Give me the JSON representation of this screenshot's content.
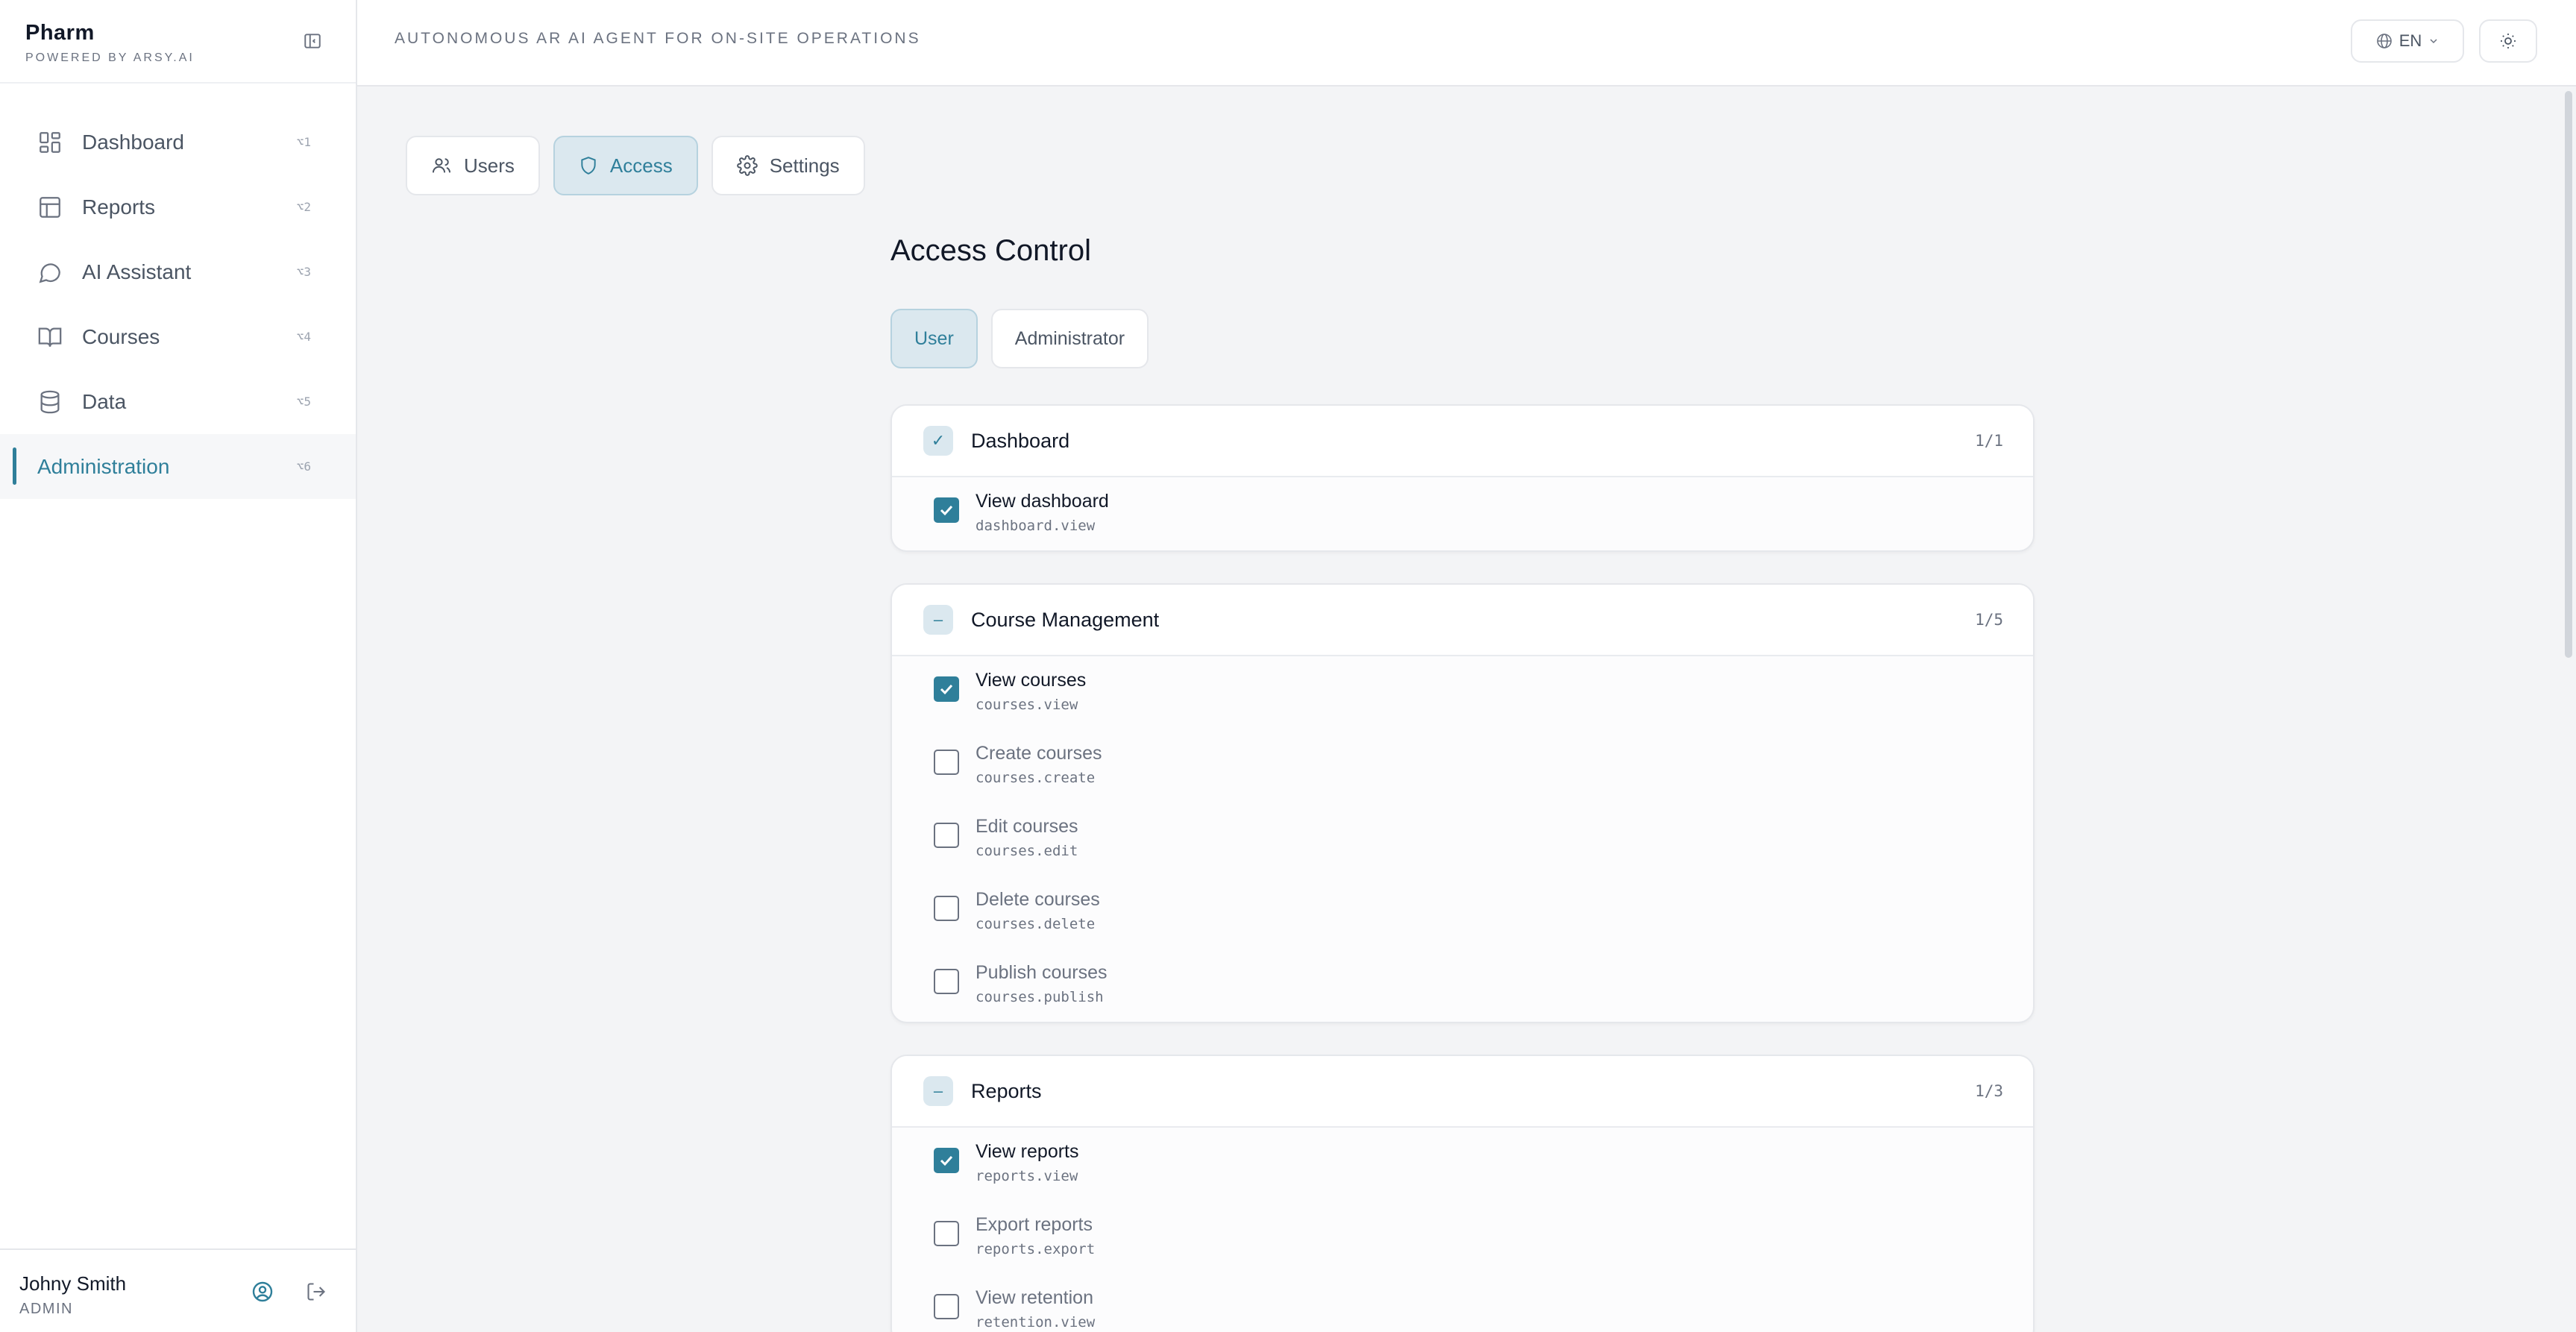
{
  "brand": {
    "name": "Pharm",
    "sub": "POWERED BY ARSY.AI"
  },
  "header": {
    "tagline": "AUTONOMOUS AR AI AGENT FOR ON-SITE OPERATIONS",
    "lang": "EN"
  },
  "sidebar": {
    "items": [
      {
        "label": "Dashboard",
        "shortcut": "⌥1",
        "icon": "dashboard-icon"
      },
      {
        "label": "Reports",
        "shortcut": "⌥2",
        "icon": "table-icon"
      },
      {
        "label": "AI Assistant",
        "shortcut": "⌥3",
        "icon": "chat-bubble-icon"
      },
      {
        "label": "Courses",
        "shortcut": "⌥4",
        "icon": "book-icon"
      },
      {
        "label": "Data",
        "shortcut": "⌥5",
        "icon": "database-icon"
      },
      {
        "label": "Administration",
        "shortcut": "⌥6",
        "active": true
      }
    ]
  },
  "user": {
    "name": "Johny Smith",
    "role": "ADMIN"
  },
  "tabs": [
    {
      "label": "Users",
      "icon": "users-icon"
    },
    {
      "label": "Access",
      "icon": "shield-icon",
      "active": true
    },
    {
      "label": "Settings",
      "icon": "gear-icon"
    }
  ],
  "page": {
    "title": "Access Control"
  },
  "roles": [
    {
      "label": "User",
      "active": true
    },
    {
      "label": "Administrator"
    }
  ],
  "groups": [
    {
      "title": "Dashboard",
      "count": "1/1",
      "toggle": "✓",
      "permissions": [
        {
          "label": "View dashboard",
          "key": "dashboard.view",
          "checked": true
        }
      ]
    },
    {
      "title": "Course Management",
      "count": "1/5",
      "toggle": "–",
      "permissions": [
        {
          "label": "View courses",
          "key": "courses.view",
          "checked": true
        },
        {
          "label": "Create courses",
          "key": "courses.create",
          "checked": false
        },
        {
          "label": "Edit courses",
          "key": "courses.edit",
          "checked": false
        },
        {
          "label": "Delete courses",
          "key": "courses.delete",
          "checked": false
        },
        {
          "label": "Publish courses",
          "key": "courses.publish",
          "checked": false
        }
      ]
    },
    {
      "title": "Reports",
      "count": "1/3",
      "toggle": "–",
      "permissions": [
        {
          "label": "View reports",
          "key": "reports.view",
          "checked": true
        },
        {
          "label": "Export reports",
          "key": "reports.export",
          "checked": false
        },
        {
          "label": "View retention",
          "key": "retention.view",
          "checked": false
        }
      ]
    }
  ],
  "colors": {
    "accent": "#2f7f9a",
    "accent_soft": "#dbe8ef"
  }
}
